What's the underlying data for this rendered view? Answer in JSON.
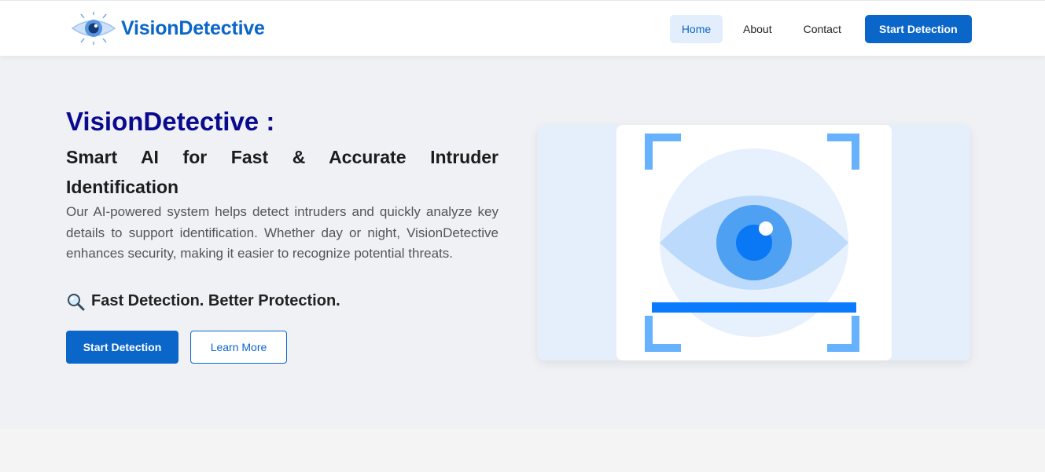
{
  "brand": {
    "name": "VisionDetective",
    "logo_icon": "eye-circuit-icon"
  },
  "nav": {
    "items": [
      {
        "label": "Home",
        "active": true
      },
      {
        "label": "About",
        "active": false
      },
      {
        "label": "Contact",
        "active": false
      }
    ],
    "cta_label": "Start Detection"
  },
  "hero": {
    "title": "VisionDetective :",
    "subtitle": "Smart AI for Fast & Accurate Intruder Identification",
    "description": "Our AI-powered system helps detect intruders and quickly analyze key details to support identification. Whether day or night, VisionDetective enhances security, making it easier to recognize potential threats.",
    "tagline": "Fast Detection. Better Protection.",
    "tagline_icon": "magnifying-glass-icon",
    "primary_button": "Start Detection",
    "secondary_button": "Learn More",
    "illustration_icon": "eye-scan-icon"
  },
  "colors": {
    "accent": "#0b66c9",
    "title": "#0a0a8f",
    "hero_bg": "#eff1f5",
    "scan_blue": "#007bff"
  }
}
